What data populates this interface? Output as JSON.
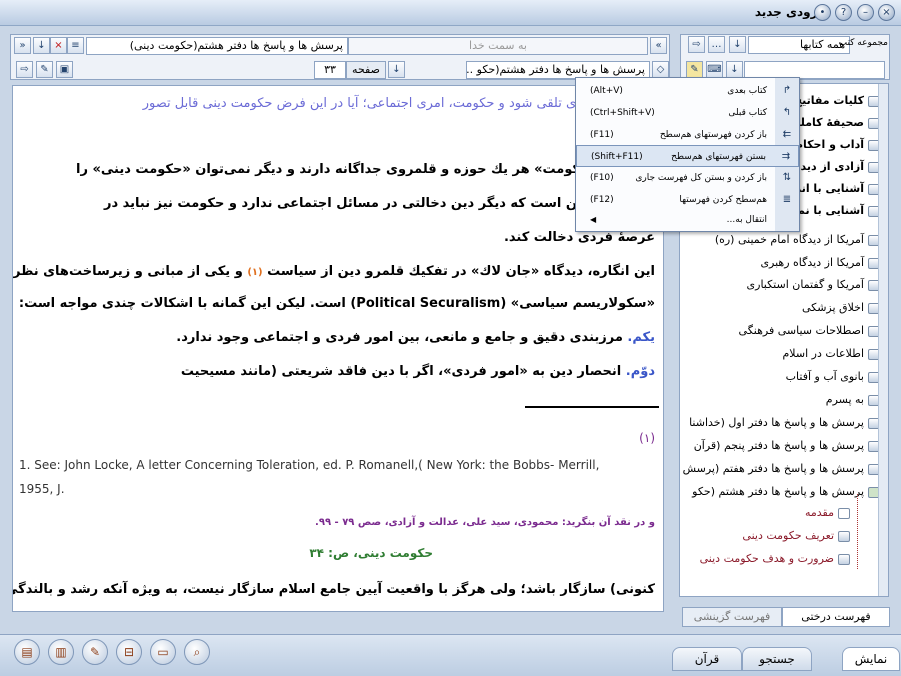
{
  "window": {
    "title": "ورودی جدید"
  },
  "doc_toolbar": {
    "nav_placeholder": "به سمت خدا",
    "breadcrumb": "پرسش ها و پاسخ ها دفتر هشتم(حکومت دینی)",
    "page_label": "صفحه",
    "page_value": "۳۳",
    "location": "پرسش ها و پاسخ ها دفتر هشتم(حکو ..."
  },
  "document": {
    "heading": "دین، امری فردی تلقی شود و حکومت، امری اجتماعی؛ آیا در این فرض حکومت دینی قابل تصور",
    "p1_l1": "«دین» و «حکومت» هر یك حوزه و قلمروی جداگانه دارند و دیگر نمی‌توان «حکومت دینی» را",
    "p1_l2": "زیرا فرض این است که دیگر دین دخالتی در مسائل اجتماعی ندارد و حکومت نیز نباید در",
    "p1_l3": "عرصهٔ فردی دخالت کند.",
    "p2_l1_a": "این انگاره، دیدگاه «جان لاك» در تفکیك قلمرو دین از سیاست",
    "p2_l1_ref": "(۱)",
    "p2_l1_b": "و یکی از مبانی و زیرساخت‌های نظری",
    "p2_l2": "«سکولاریسم سیاسی» (Political Securalism) است. لیکن این گمانه با اشکالات چندی مواجه است:",
    "p3_label": "یکم.",
    "p3_text": "مرزبندی دقیق و جامع و مانعی، بین امور فردی و اجتماعی وجود ندارد.",
    "p4_label": "دوّم.",
    "p4_text": "انحصار دین به «امور فردی»، اگر با دین فاقد شریعتی (مانند مسیحیت",
    "footnote_num": "(۱)",
    "footnote_en_1": "1. See: John Locke, A letter Concerning Toleration, ed. P. Romanell,( New York: the Bobbs- Merrill,",
    "footnote_en_2": "1955, J.",
    "footnote_fa": "و در نقد آن بنگرید: محمودی، سید علی، عدالت و آزادی، صص ۷۹ - ۹۹.",
    "page_marker": "حکومت دینی، ص: ۳۴",
    "last_line": "کنونی) سازگار باشد؛ ولی هرگز با واقعیت آیین جامع اسلام سازگار نیست، به ویژه آنکه رشد و بالندگی"
  },
  "right_toolbar": {
    "collection_label": "مجموعه کتب",
    "collection_value": "همه کتابها",
    "search_value": ""
  },
  "tree": {
    "items": [
      "کلیات مفاتیح",
      "صحیفهٔ کامله",
      "آداب و احکام",
      "آزادی از دید",
      "آشنایی با اند",
      "آشنایی با نما",
      "آمریکا از دیدگاه امام خمینی (ره)",
      "آمریکا از دیدگاه رهبری",
      "آمریکا و گفتمان استکباری",
      "اخلاق پزشکی",
      "اصطلاحات سیاسی فرهنگی",
      "اطلاعات در اسلام",
      "بانوی آب و آفتاب",
      "به پسرم",
      "پرسش ها و پاسخ ها دفتر اول (خداشنا",
      "پرسش ها و پاسخ ها دفتر پنجم (قرآن",
      "پرسش ها و پاسخ ها دفتر هفتم (پرسش",
      "پرسش ها و پاسخ ها دفتر هشتم (حکو"
    ],
    "sub_items": [
      "مقدمه",
      "تعریف حکومت دینی",
      "ضرورت و هدف حکومت دینی"
    ]
  },
  "context_menu": {
    "items": [
      {
        "label": "کتاب بعدی",
        "shortcut": "(Alt+V)",
        "icon": "next-book-icon"
      },
      {
        "label": "کتاب قبلی",
        "shortcut": "(Ctrl+Shift+V)",
        "icon": "prev-book-icon"
      },
      {
        "label": "باز کردن فهرستهای هم‌سطح",
        "shortcut": "(F11)",
        "icon": "expand-level-icon"
      },
      {
        "label": "بستن فهرستهای هم‌سطح",
        "shortcut": "(Shift+F11)",
        "icon": "collapse-level-icon"
      },
      {
        "label": "باز کردن و بستن کل فهرست جاری",
        "shortcut": "(F10)",
        "icon": "toggle-all-icon"
      },
      {
        "label": "هم‌سطح کردن فهرستها",
        "shortcut": "(F12)",
        "icon": "align-lists-icon"
      },
      {
        "label": "انتقال به...",
        "shortcut": "",
        "icon": "submenu-arrow-icon"
      }
    ]
  },
  "side_tabs": {
    "tree_tab": "فهرست درختی",
    "index_tab": "فهرست گزینشی"
  },
  "bottom_tabs": {
    "display": "نمایش",
    "search": "جستجو",
    "quran": "قرآن"
  },
  "colors": {
    "heading": "#6b6bd6",
    "ref": "#e07020",
    "label": "#3a56c8",
    "footnote": "#7b2b8f",
    "marker": "#2f7d32",
    "sub_items": "#8b1a2a"
  }
}
